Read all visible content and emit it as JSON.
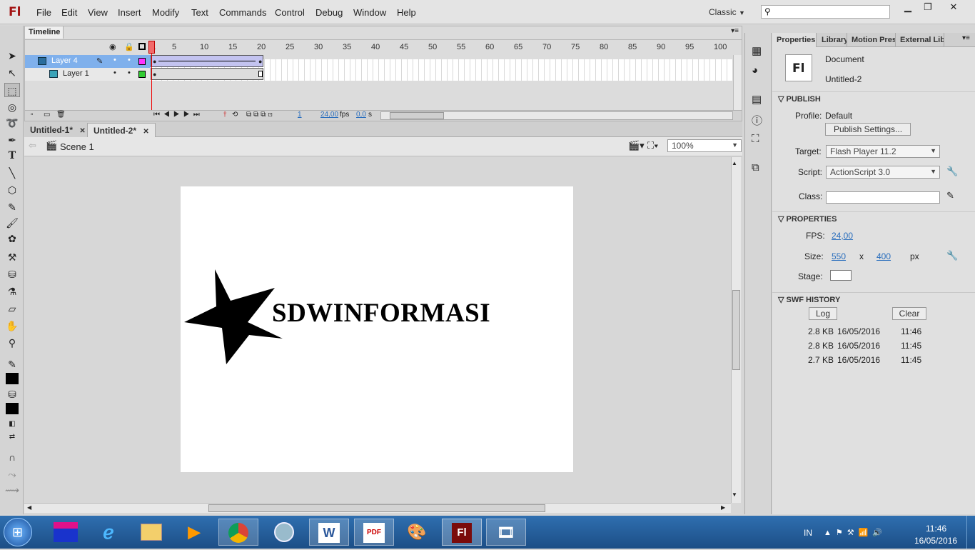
{
  "app": {
    "logo": "Fl",
    "workspace": "Classic"
  },
  "menu": [
    "File",
    "Edit",
    "View",
    "Insert",
    "Modify",
    "Text",
    "Commands",
    "Control",
    "Debug",
    "Window",
    "Help"
  ],
  "timeline": {
    "tab": "Timeline",
    "ruler": [
      "1",
      "5",
      "10",
      "15",
      "20",
      "25",
      "30",
      "35",
      "40",
      "45",
      "50",
      "55",
      "60",
      "65",
      "70",
      "75",
      "80",
      "85",
      "90",
      "95",
      "100"
    ],
    "layers": [
      {
        "name": "Layer 4",
        "selected": true,
        "color": "#ff33ff"
      },
      {
        "name": "Layer 1",
        "selected": false,
        "color": "#33cc33"
      }
    ],
    "status": {
      "frame": "1",
      "fps": "24,00",
      "fps_unit": "fps",
      "time": "0,0",
      "time_unit": "s"
    }
  },
  "documents": [
    {
      "name": "Untitled-1*"
    },
    {
      "name": "Untitled-2*"
    }
  ],
  "editbar": {
    "scene": "Scene 1",
    "zoom": "100%"
  },
  "stage": {
    "text": "SDWINFORMASI"
  },
  "properties": {
    "tabs": [
      "Properties",
      "Library",
      "Motion Prese",
      "External Libra"
    ],
    "doc_type": "Document",
    "doc_name": "Untitled-2",
    "doc_icon": "Fl",
    "publish": {
      "heading": "PUBLISH",
      "profile_label": "Profile:",
      "profile": "Default",
      "settings_btn": "Publish Settings...",
      "target_label": "Target:",
      "target": "Flash Player 11.2",
      "script_label": "Script:",
      "script": "ActionScript 3.0",
      "class_label": "Class:"
    },
    "props": {
      "heading": "PROPERTIES",
      "fps_label": "FPS:",
      "fps": "24,00",
      "size_label": "Size:",
      "width": "550",
      "x": "x",
      "height": "400",
      "unit": "px",
      "stage_label": "Stage:",
      "stage_color": "#ffffff"
    },
    "history": {
      "heading": "SWF HISTORY",
      "log_btn": "Log",
      "clear_btn": "Clear",
      "rows": [
        [
          "2.8 KB",
          "16/05/2016",
          "11:46"
        ],
        [
          "2.8 KB",
          "16/05/2016",
          "11:45"
        ],
        [
          "2.7 KB",
          "16/05/2016",
          "11:45"
        ]
      ]
    }
  },
  "taskbar": {
    "lang": "IN",
    "time": "11:46",
    "date": "16/05/2016",
    "apps": [
      "W",
      "PDF",
      "Fl"
    ]
  }
}
